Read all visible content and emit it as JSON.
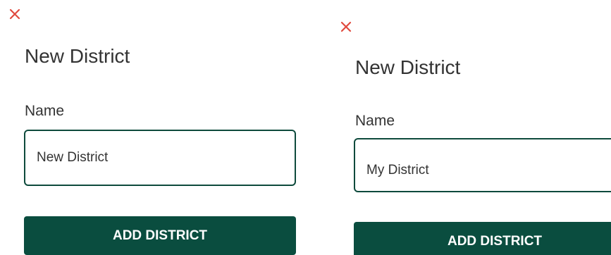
{
  "colors": {
    "close_icon": "#e04a3f",
    "accent_dark_green": "#0a4d3f",
    "input_border": "#0e4a3c",
    "text": "#333333"
  },
  "dialogs": [
    {
      "close_icon": "close-icon",
      "title": "New District",
      "name_label": "Name",
      "name_value": "New District",
      "submit_label": "ADD DISTRICT"
    },
    {
      "close_icon": "close-icon",
      "title": "New District",
      "name_label": "Name",
      "name_value": "My District",
      "submit_label": "ADD DISTRICT"
    }
  ]
}
